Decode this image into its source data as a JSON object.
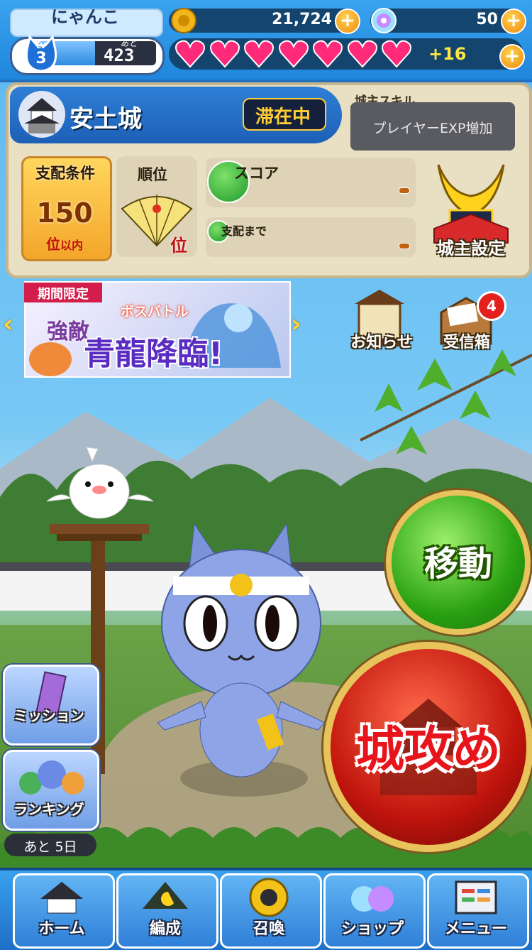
{
  "player": {
    "name": "にゃんこ",
    "level_label": "LV",
    "level": "3",
    "exp_left_label": "あと",
    "exp_left": "423",
    "exp_progress": 0.48
  },
  "currency": {
    "coins": "21,724",
    "gems": "50",
    "hearts_count": 7,
    "hearts_extra": "+16"
  },
  "castle": {
    "name": "安土城",
    "status": "滞在中",
    "skill_label": "城主スキル",
    "skill_text": "プレイヤーEXP増加",
    "condition_label": "支配条件",
    "condition_rank": "150",
    "condition_suffix_1": "位",
    "condition_suffix_2": "以内",
    "rank_label": "順位",
    "rank_suffix": "位",
    "score_label": "スコア",
    "domination_label": "支配まで",
    "lord_settings_label": "城主設定"
  },
  "banner": {
    "tag": "期間限定",
    "subtitle": "ボスバトル",
    "enemy": "強敵",
    "title": "青龍降臨!",
    "prev": "‹",
    "next": "›"
  },
  "shortcuts": {
    "notice_label": "お知らせ",
    "inbox_label": "受信箱",
    "inbox_badge": "4"
  },
  "actions": {
    "move_label": "移動",
    "attack_label": "城攻め"
  },
  "side": {
    "mission_label": "ミッション",
    "ranking_label": "ランキング",
    "days_left": "あと 5日"
  },
  "nav": [
    {
      "label": "ホーム",
      "icon": "castle-icon"
    },
    {
      "label": "編成",
      "icon": "team-icon"
    },
    {
      "label": "召喚",
      "icon": "summon-icon"
    },
    {
      "label": "ショップ",
      "icon": "shop-icon"
    },
    {
      "label": "メニュー",
      "icon": "menu-icon"
    }
  ],
  "colors": {
    "accent_blue": "#1f86dc",
    "gold": "#e8c25a",
    "heart": "#ff2a7a",
    "move_green": "#2aa212",
    "attack_red": "#c0140c"
  }
}
